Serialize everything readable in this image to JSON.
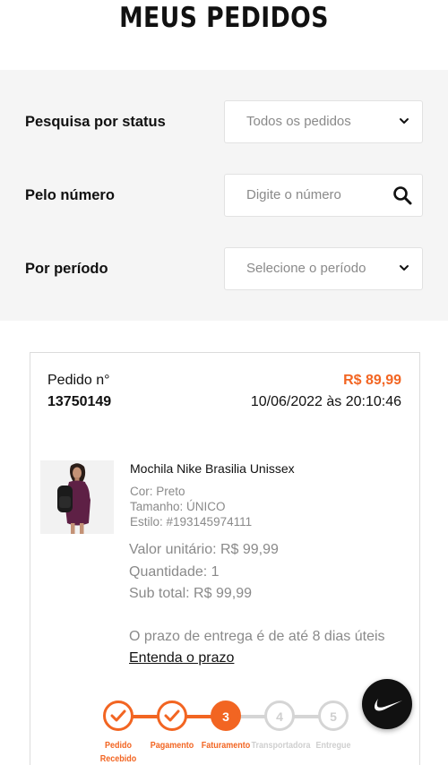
{
  "page": {
    "title": "MEUS PEDIDOS"
  },
  "filters": {
    "status": {
      "label": "Pesquisa por status",
      "value": "Todos os pedidos"
    },
    "number": {
      "label": "Pelo número",
      "placeholder": "Digite o número"
    },
    "period": {
      "label": "Por período",
      "value": "Selecione o período"
    }
  },
  "order": {
    "label": "Pedido n°",
    "number": "13750149",
    "total": "R$ 89,99",
    "date": "10/06/2022 às 20:10:46",
    "item": {
      "name": "Mochila Nike Brasilia Unissex",
      "color": "Cor: Preto",
      "size": "Tamanho: ÚNICO",
      "style": "Estilo: #193145974111",
      "unit_price": "Valor unitário: R$ 99,99",
      "quantity": "Quantidade: 1",
      "subtotal": "Sub total: R$ 99,99"
    },
    "delivery": {
      "text": "O prazo de entrega é de até 8 dias úteis",
      "link": "Entenda o prazo"
    },
    "tracker": {
      "accent": "#f26522",
      "inactive": "#d5d5d5",
      "steps": [
        {
          "number": "",
          "label": "Pedido Recebido",
          "state": "done"
        },
        {
          "number": "",
          "label": "Pagamento",
          "state": "done"
        },
        {
          "number": "3",
          "label": "Faturamento",
          "state": "current"
        },
        {
          "number": "4",
          "label": "Transportadora",
          "state": "pending"
        },
        {
          "number": "5",
          "label": "Entregue",
          "state": "pending"
        }
      ]
    }
  },
  "fab": {
    "icon": "nike-swoosh-icon"
  }
}
